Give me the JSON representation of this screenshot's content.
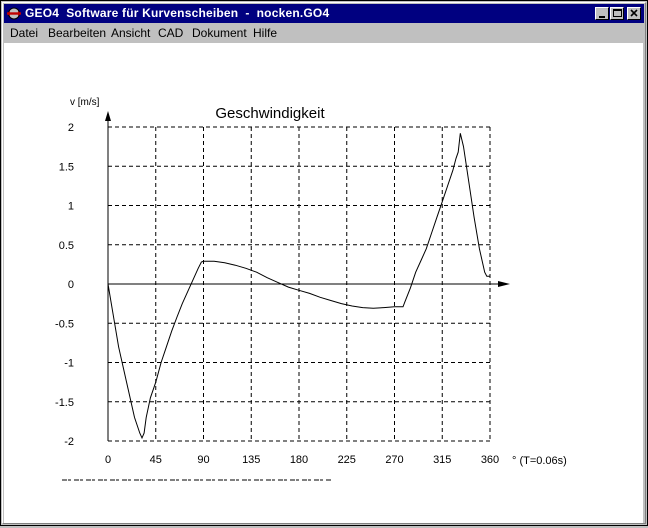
{
  "window": {
    "title": "GEO4  Software für Kurvenscheiben  -  nocken.GO4"
  },
  "menu": [
    {
      "label": "Datei"
    },
    {
      "label": "Bearbeiten"
    },
    {
      "label": "Ansicht"
    },
    {
      "label": "CAD"
    },
    {
      "label": "Dokument"
    },
    {
      "label": "Hilfe"
    }
  ],
  "chart_data": {
    "type": "line",
    "title": "Geschwindigkeit",
    "ylabel": "v [m/s]",
    "xlabel": "° (T=0.06s)",
    "xlim": [
      0,
      360
    ],
    "ylim": [
      -2,
      2
    ],
    "x_ticks": [
      "0",
      "45",
      "90",
      "135",
      "180",
      "225",
      "270",
      "315",
      "360"
    ],
    "y_ticks": [
      "2",
      "1.5",
      "1",
      "0.5",
      "0",
      "-0.5",
      "-1",
      "-1.5",
      "-2"
    ],
    "grid": true,
    "series": [
      {
        "x": [
          0,
          5,
          10,
          15,
          20,
          25,
          30,
          32,
          34,
          36,
          40,
          45,
          50,
          55,
          60,
          65,
          70,
          75,
          80,
          85,
          88,
          90,
          95,
          100,
          105,
          110,
          120,
          130,
          140,
          150,
          160,
          170,
          180,
          190,
          200,
          210,
          220,
          230,
          240,
          250,
          260,
          270,
          275,
          278,
          280,
          285,
          290,
          295,
          300,
          305,
          310,
          315,
          320,
          325,
          328,
          330,
          332,
          335,
          340,
          345,
          350,
          355,
          357,
          360
        ],
        "y": [
          0,
          -0.4,
          -0.8,
          -1.1,
          -1.4,
          -1.7,
          -1.9,
          -1.96,
          -1.9,
          -1.7,
          -1.45,
          -1.25,
          -1.0,
          -0.8,
          -0.6,
          -0.42,
          -0.25,
          -0.1,
          0.05,
          0.2,
          0.28,
          0.29,
          0.29,
          0.29,
          0.28,
          0.27,
          0.24,
          0.2,
          0.15,
          0.08,
          0.02,
          -0.04,
          -0.08,
          -0.12,
          -0.17,
          -0.21,
          -0.25,
          -0.28,
          -0.3,
          -0.31,
          -0.3,
          -0.29,
          -0.29,
          -0.29,
          -0.22,
          -0.05,
          0.15,
          0.3,
          0.45,
          0.65,
          0.85,
          1.05,
          1.25,
          1.45,
          1.6,
          1.68,
          1.92,
          1.75,
          1.3,
          0.85,
          0.45,
          0.15,
          0.1,
          0.1
        ]
      }
    ]
  }
}
